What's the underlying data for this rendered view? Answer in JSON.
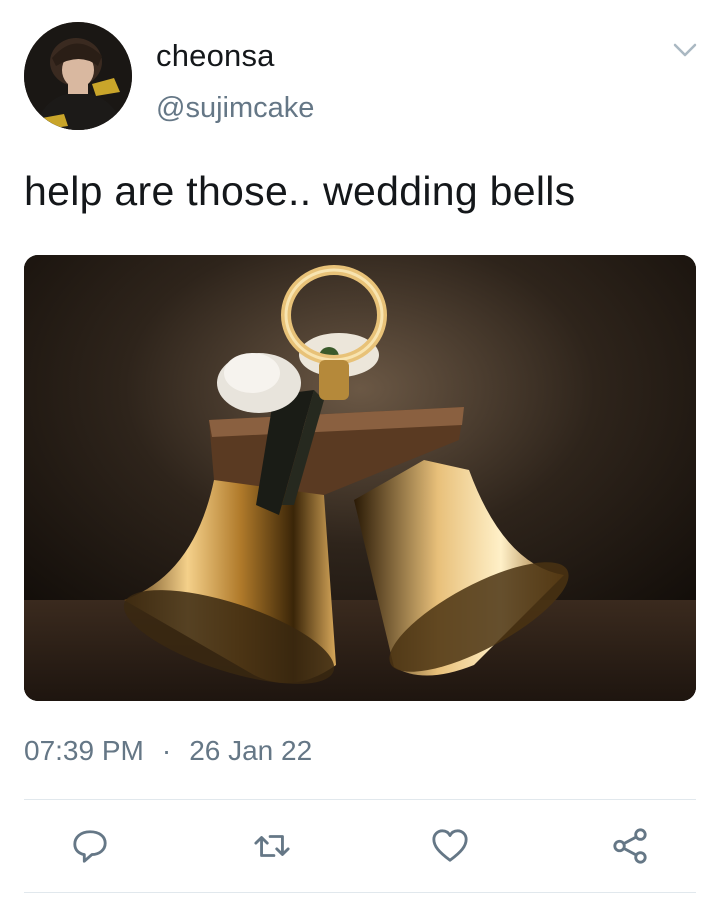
{
  "tweet": {
    "display_name": "cheonsa",
    "handle": "@sujimcake",
    "text": "help are those.. wedding bells",
    "time": "07:39 PM",
    "separator": "·",
    "date": "26 Jan 22"
  },
  "icons": {
    "menu": "chevron-down-icon",
    "reply": "reply-icon",
    "retweet": "retweet-icon",
    "like": "heart-icon",
    "share": "share-icon"
  },
  "colors": {
    "text": "#14171a",
    "secondary": "#657786",
    "divider": "#e1e8ed"
  }
}
